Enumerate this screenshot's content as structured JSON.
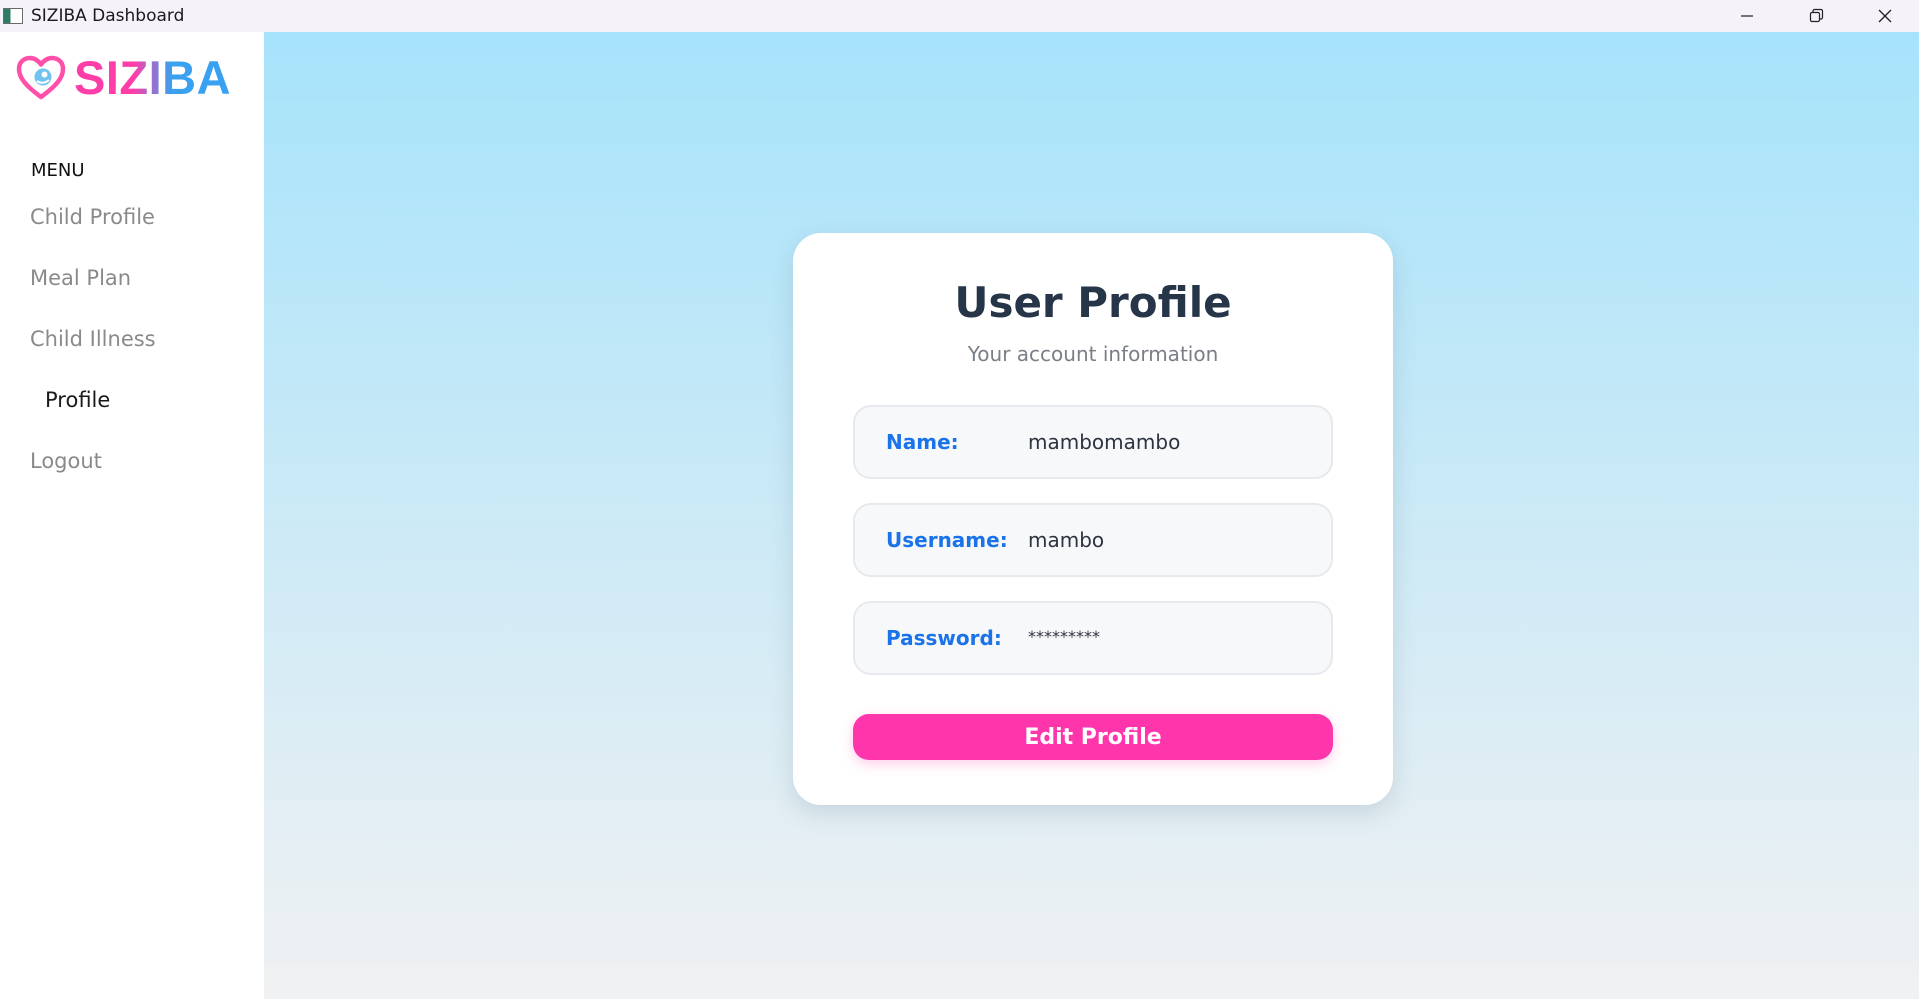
{
  "window": {
    "title": "SIZIBA Dashboard",
    "icon": "app-window-icon",
    "controls": [
      "minimize-icon",
      "restore-icon",
      "close-icon"
    ]
  },
  "sidebar": {
    "logo_text": "SIZIBA",
    "logo_icon": "heart-baby-icon",
    "menu_heading": "MENU",
    "items": [
      {
        "label": "Child Profile",
        "active": false
      },
      {
        "label": "Meal Plan",
        "active": false
      },
      {
        "label": "Child Illness",
        "active": false
      },
      {
        "label": "Profile",
        "active": true
      },
      {
        "label": "Logout",
        "active": false
      }
    ]
  },
  "profile_card": {
    "title": "User Profile",
    "subtitle": "Your account information",
    "fields": [
      {
        "label": "Name:",
        "value": "mambomambo"
      },
      {
        "label": "Username:",
        "value": "mambo"
      },
      {
        "label": "Password:",
        "value": "*********"
      }
    ],
    "edit_button_label": "Edit Profile"
  },
  "colors": {
    "brand_pink": "#ff36ab",
    "brand_blue": "#3aa0f0",
    "label_blue": "#1a73e8",
    "title_dark": "#263548",
    "bg_top": "#a6e3fb",
    "bg_bottom": "#f0f1f2"
  }
}
